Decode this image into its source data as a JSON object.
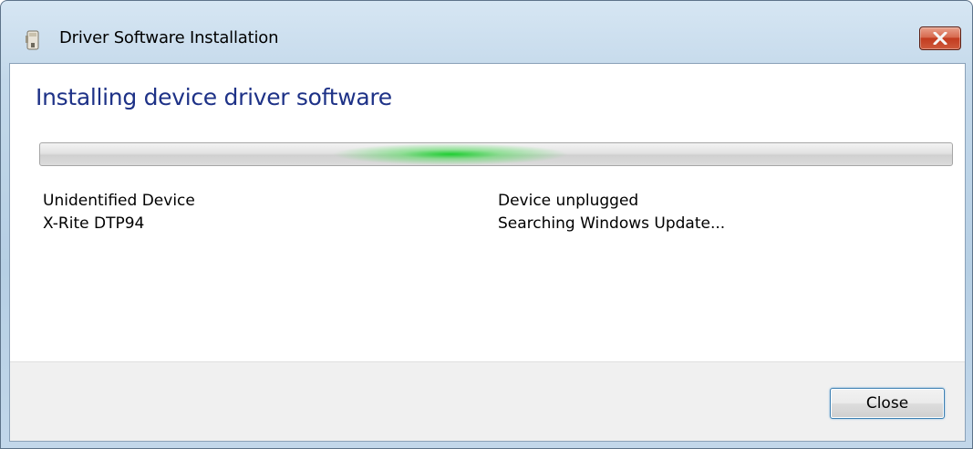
{
  "window": {
    "title": "Driver Software Installation",
    "title_icon": "usb-drive-icon",
    "close_icon": "close-icon"
  },
  "content": {
    "heading": "Installing device driver software",
    "progress": {
      "state": "indeterminate-marquee",
      "glow_color": "#1ccc2c"
    },
    "rows": [
      {
        "device": "Unidentified Device",
        "status": "Device unplugged"
      },
      {
        "device": "X-Rite DTP94",
        "status": "Searching Windows Update..."
      }
    ]
  },
  "footer": {
    "close_label": "Close"
  },
  "colors": {
    "heading": "#1e3287",
    "frame": "#b6cfe4",
    "close_button_red": "#c23b1f"
  }
}
